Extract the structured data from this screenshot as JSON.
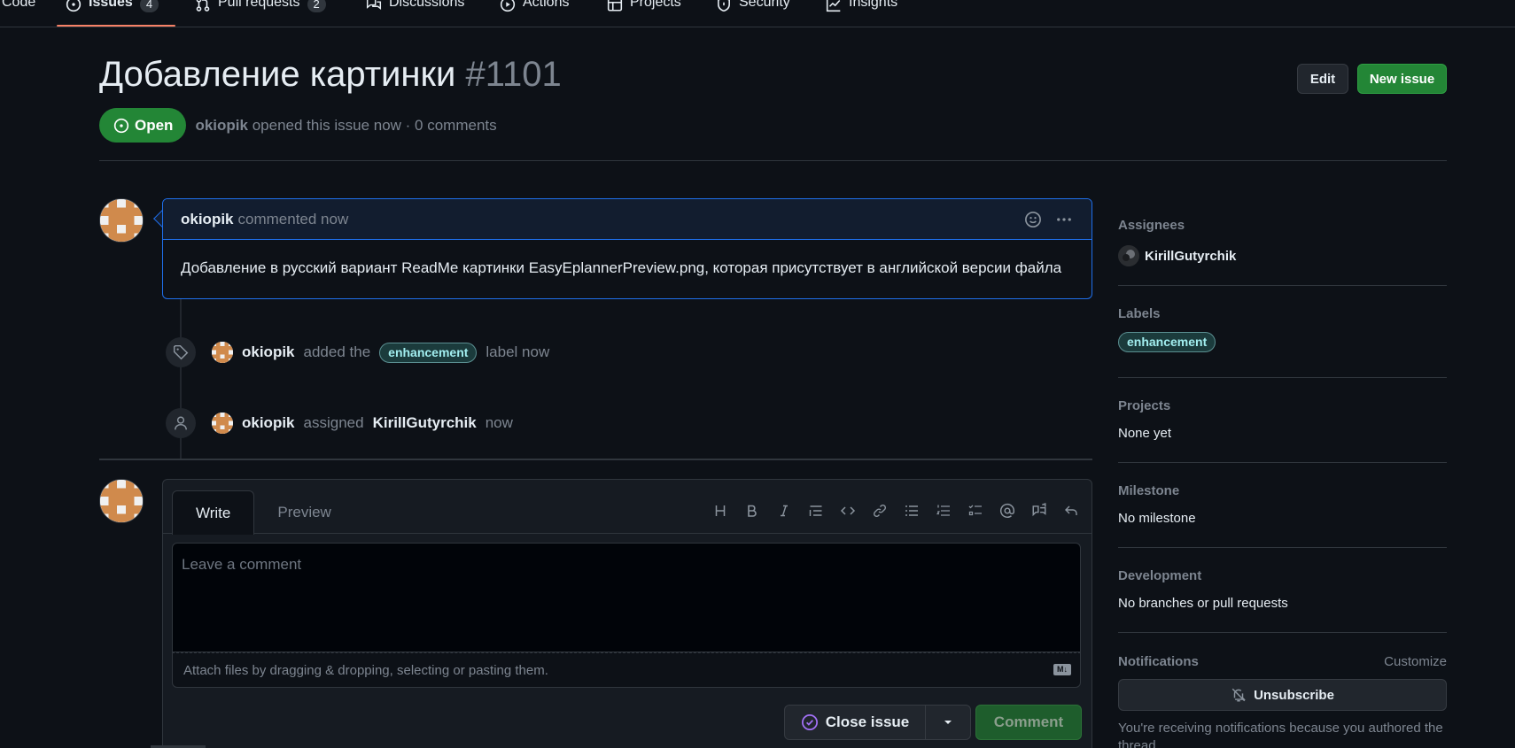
{
  "nav": {
    "tabs": [
      {
        "label": "Code",
        "icon": "code-icon"
      },
      {
        "label": "Issues",
        "count": "4",
        "icon": "issue-opened-icon"
      },
      {
        "label": "Pull requests",
        "count": "2",
        "icon": "git-pull-request-icon"
      },
      {
        "label": "Discussions",
        "icon": "comment-discussion-icon"
      },
      {
        "label": "Actions",
        "icon": "play-icon"
      },
      {
        "label": "Projects",
        "icon": "table-icon"
      },
      {
        "label": "Security",
        "icon": "shield-icon"
      },
      {
        "label": "Insights",
        "icon": "graph-icon"
      }
    ],
    "active_tab": "Issues"
  },
  "issue": {
    "title": "Добавление картинки",
    "number": "#1101",
    "state": "Open",
    "author": "okiopik",
    "meta_rest": "opened this issue now · 0 comments",
    "edit_label": "Edit",
    "new_issue_label": "New issue"
  },
  "comment": {
    "author": "okiopik",
    "time": "commented now",
    "body": "Добавление в русский вариант ReadMe картинки EasyEplannerPreview.png, которая присутствует в английской версии файла"
  },
  "events": [
    {
      "actor": "okiopik",
      "pre": "added the",
      "label": "enhancement",
      "post": "label now",
      "icon": "tag-icon"
    },
    {
      "actor": "okiopik",
      "pre": "assigned",
      "target": "KirillGutyrchik",
      "post": "now",
      "icon": "person-icon"
    }
  ],
  "editor": {
    "tab_write": "Write",
    "tab_preview": "Preview",
    "placeholder": "Leave a comment",
    "attach_hint": "Attach files by dragging & dropping, selecting or pasting them.",
    "close_label": "Close issue",
    "comment_label": "Comment"
  },
  "sidebar": {
    "assignees_title": "Assignees",
    "assignee": "KirillGutyrchik",
    "labels_title": "Labels",
    "label": "enhancement",
    "projects_title": "Projects",
    "projects_value": "None yet",
    "milestone_title": "Milestone",
    "milestone_value": "No milestone",
    "development_title": "Development",
    "development_value": "No branches or pull requests",
    "notifications_title": "Notifications",
    "customize_label": "Customize",
    "unsubscribe_label": "Unsubscribe",
    "notif_note": "You're receiving notifications because you authored the thread."
  },
  "colors": {
    "background": "#0d1117",
    "open_green": "#238636",
    "accent_blue": "#1f6feb",
    "label_bg": "#1b3b3c",
    "label_text": "#a2eeef"
  }
}
